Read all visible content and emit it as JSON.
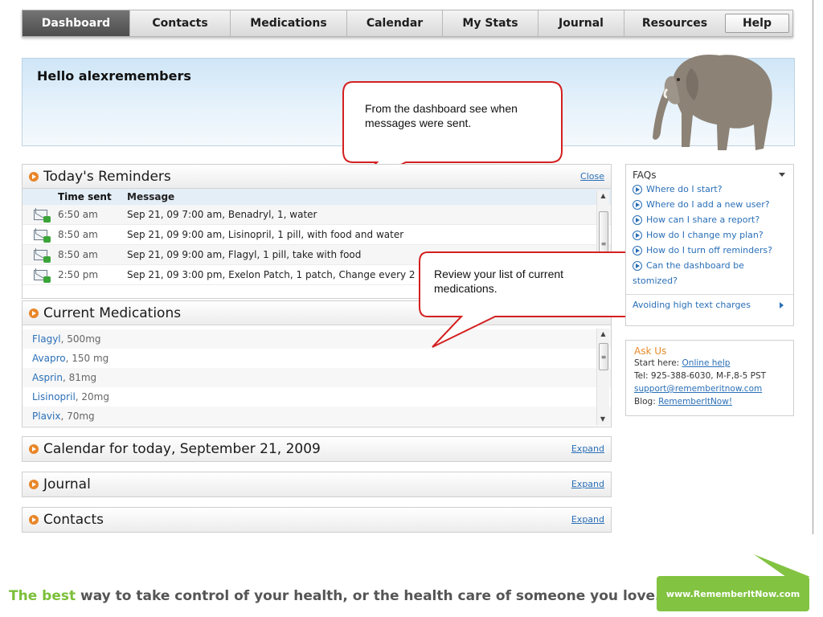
{
  "nav": {
    "tabs": [
      "Dashboard",
      "Contacts",
      "Medications",
      "Calendar",
      "My Stats",
      "Journal",
      "Resources"
    ],
    "help": "Help",
    "active": "Dashboard"
  },
  "banner": {
    "greeting": "Hello alexremembers"
  },
  "callouts": {
    "messages": "From the dashboard see when messages were sent.",
    "medications": "Review your list of current medications."
  },
  "reminders": {
    "title": "Today's Reminders",
    "close": "Close",
    "header_time": "Time sent",
    "header_message": "Message",
    "rows": [
      {
        "time": "6:50 am",
        "message": "Sep 21, 09 7:00 am, Benadryl, 1, water"
      },
      {
        "time": "8:50 am",
        "message": "Sep 21, 09 9:00 am, Lisinopril, 1 pill, with food and water"
      },
      {
        "time": "8:50 am",
        "message": "Sep 21, 09 9:00 am, Flagyl, 1 pill, take with food"
      },
      {
        "time": "2:50 pm",
        "message": "Sep 21, 09 3:00 pm, Exelon Patch, 1 patch, Change every 2"
      }
    ]
  },
  "medications": {
    "title": "Current Medications",
    "rows": [
      {
        "name": "Flagyl",
        "dose": ", 500mg"
      },
      {
        "name": "Avapro",
        "dose": ", 150 mg"
      },
      {
        "name": "Asprin",
        "dose": ", 81mg"
      },
      {
        "name": "Lisinopril",
        "dose": ", 20mg"
      },
      {
        "name": "Plavix",
        "dose": ", 70mg"
      }
    ]
  },
  "calendar": {
    "title": "Calendar for today, September 21, 2009",
    "expand": "Expand"
  },
  "journal": {
    "title": "Journal",
    "expand": "Expand"
  },
  "contacts": {
    "title": "Contacts",
    "expand": "Expand"
  },
  "faqs": {
    "title": "FAQs",
    "items": [
      "Where do I start?",
      "Where do I add a new user?",
      "How can I share a report?",
      "How do I change my plan?",
      "How do I turn off reminders?",
      "Can the dashboard be",
      "stomized?"
    ],
    "avoid": "Avoiding high text charges"
  },
  "ask": {
    "title": "Ask Us",
    "start_label": "Start here: ",
    "start_link": "Online help",
    "tel": "Tel: 925-388-6030, M-F,8-5 PST",
    "email": "support@rememberitnow.com",
    "blog_label": "Blog: ",
    "blog_link": "RememberItNow!"
  },
  "footer": {
    "accent": "The best",
    "rest": " way to take control of your health, or the health care of someone you love.",
    "badge": "www.RememberItNow.com"
  },
  "colors": {
    "accent_orange": "#e8872a",
    "link_blue": "#2a6fb7",
    "brand_green": "#82c341",
    "callout_red": "#d42020"
  }
}
